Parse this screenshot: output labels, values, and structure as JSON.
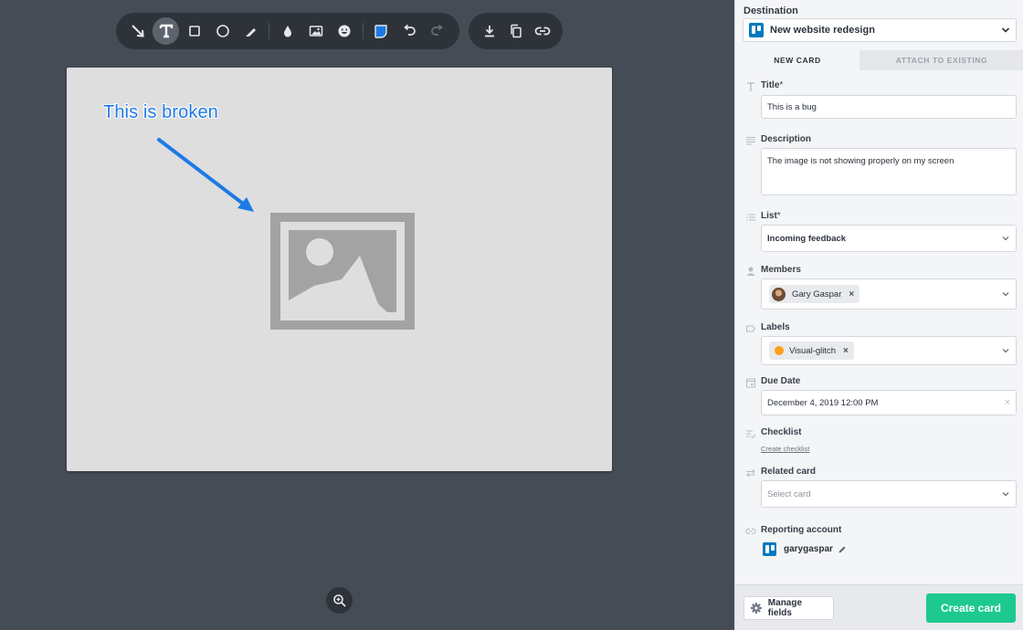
{
  "toolbar": {
    "tools": [
      "arrow-tool",
      "text-tool",
      "rectangle-tool",
      "ellipse-tool",
      "pen-tool",
      "blur-tool",
      "image-tool",
      "emoji-tool",
      "color-picker",
      "undo",
      "redo"
    ],
    "active_tool": "text-tool",
    "active_color": "#1e7ae6",
    "share_actions": [
      "download",
      "copy",
      "link"
    ]
  },
  "canvas": {
    "annotation_text": "This is broken",
    "annotation_color": "#1e7ae6"
  },
  "panel": {
    "destination_label": "Destination",
    "destination_value": "New website redesign",
    "tabs": [
      {
        "label": "NEW CARD",
        "active": true
      },
      {
        "label": "ATTACH TO EXISTING",
        "active": false
      }
    ],
    "fields": {
      "title": {
        "label": "Title",
        "required": "*",
        "value": "This is a bug"
      },
      "description": {
        "label": "Description",
        "value": "The image is not showing properly on my screen"
      },
      "list": {
        "label": "List",
        "required": "*",
        "value": "Incoming feedback"
      },
      "members": {
        "label": "Members",
        "chips": [
          "Gary Gaspar"
        ]
      },
      "labels": {
        "label": "Labels",
        "chips": [
          "Visual-glitch"
        ],
        "chip_color": "#ff9f1a"
      },
      "due_date": {
        "label": "Due Date",
        "value": "December 4, 2019 12:00 PM"
      },
      "checklist": {
        "label": "Checklist",
        "link": "Create checklist"
      },
      "related_card": {
        "label": "Related card",
        "placeholder": "Select card"
      },
      "reporting_account": {
        "label": "Reporting account",
        "value": "garygaspar"
      }
    },
    "footer": {
      "manage_label": "Manage fields",
      "create_label": "Create card"
    },
    "accent_color": "#1dc98e",
    "brand_color": "#0079bf"
  }
}
